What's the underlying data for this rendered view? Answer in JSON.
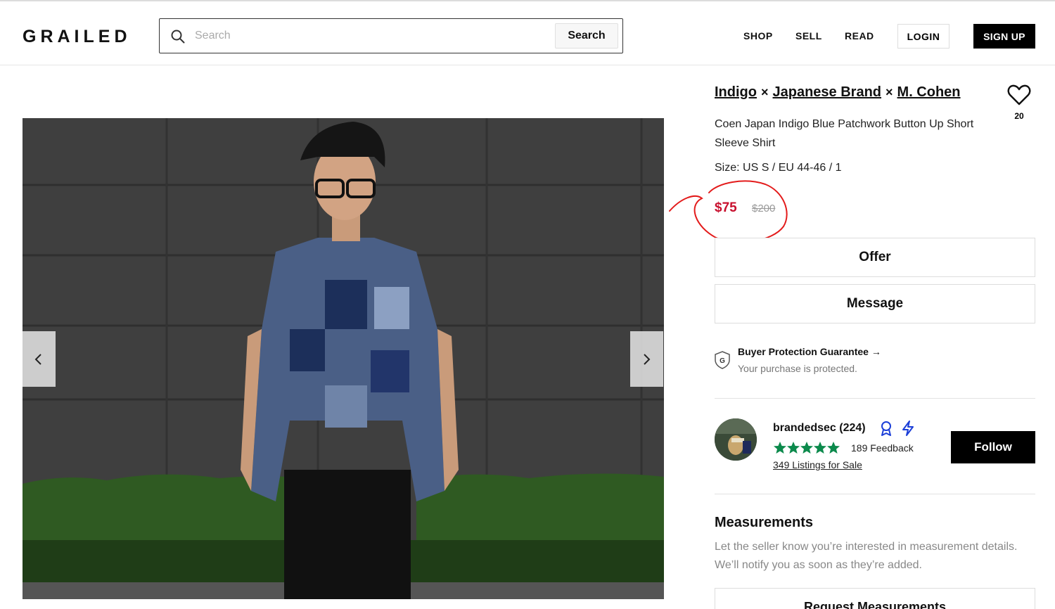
{
  "header": {
    "logo": "GRAILED",
    "search": {
      "placeholder": "Search",
      "button_label": "Search"
    },
    "nav": {
      "shop": "SHOP",
      "sell": "SELL",
      "read": "READ"
    },
    "login_label": "LOGIN",
    "signup_label": "SIGN UP"
  },
  "listing": {
    "brands": [
      "Indigo",
      "Japanese Brand",
      "M. Cohen"
    ],
    "brand_separator": "×",
    "favorites_count": "20",
    "title": "Coen Japan Indigo Blue Patchwork Button Up Short Sleeve Shirt",
    "size": "Size: US S / EU 44-46 / 1",
    "price": "$75",
    "original_price": "$200",
    "price_color": "#c8102e"
  },
  "actions": {
    "offer_label": "Offer",
    "message_label": "Message"
  },
  "buyer_protection": {
    "title": "Buyer Protection Guarantee →",
    "subtitle": "Your purchase is protected.",
    "shield_letter": "G"
  },
  "seller": {
    "name": "brandedsec",
    "count": "(224)",
    "rating_stars": 5,
    "feedback": "189 Feedback",
    "listings": "349 Listings for Sale",
    "follow_label": "Follow",
    "star_color": "#0c8a4c",
    "badge_color": "#1c3fd8"
  },
  "measurements": {
    "title": "Measurements",
    "text": "Let the seller know you’re interested in measurement details. We’ll notify you as soon as they’re added.",
    "request_label": "Request Measurements"
  },
  "gallery": {
    "prev_icon": "chevron-left-icon",
    "next_icon": "chevron-right-icon"
  },
  "annotation": {
    "color": "#e31b1b",
    "shape": "hand-drawn circle around price"
  }
}
